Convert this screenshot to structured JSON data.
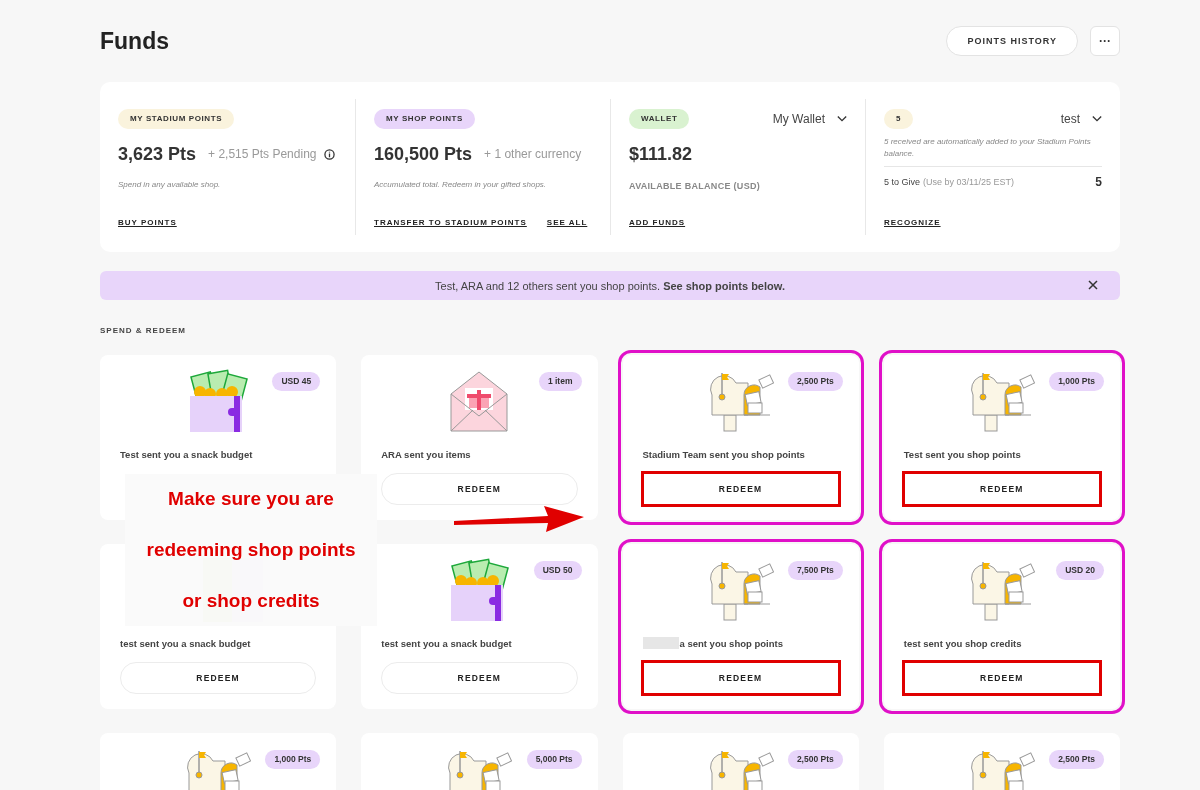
{
  "page": {
    "title": "Funds",
    "history_button": "POINTS HISTORY",
    "more_button": "···"
  },
  "panels": [
    {
      "kind": "points",
      "tag": "MY STADIUM POINTS",
      "color": "#faf3dd",
      "amount": "3,623 Pts",
      "extra": "+ 2,515 Pts Pending",
      "info": true,
      "note": "Spend in any available shop.",
      "links": [
        "BUY POINTS"
      ]
    },
    {
      "kind": "points",
      "tag": "MY SHOP POINTS",
      "color": "#e8d5fa",
      "amount": "160,500 Pts",
      "extra": "+ 1 other currency",
      "note": "Accumulated total. Redeem in your gifted shops.",
      "links": [
        "TRANSFER TO STADIUM POINTS",
        "SEE ALL"
      ]
    },
    {
      "kind": "wallet",
      "tag": "WALLET",
      "color": "#d9f2d0",
      "dropdown": "My Wallet",
      "amount": "$111.82",
      "caption": "AVAILABLE BALANCE (USD)",
      "links": [
        "ADD FUNDS"
      ]
    },
    {
      "kind": "give",
      "tag": "5",
      "color": "#faf3dd",
      "dropdown": "test",
      "note": "5 received are automatically added to your Stadium Points balance.",
      "give_label": "5 to Give",
      "give_expiry": "(Use by 03/11/25 EST)",
      "give_count": "5",
      "links": [
        "RECOGNIZE"
      ]
    }
  ],
  "banner": {
    "text": "Test, ARA and 12 others sent you shop points. **See shop points below.**"
  },
  "section_title": "SPEND & REDEEM",
  "cards": [
    {
      "kind": "wallet",
      "badge": "USD 45",
      "message": "Test sent you a snack budget",
      "highlighted": false,
      "name_redacted": false
    },
    {
      "kind": "envelope",
      "badge": "1 item",
      "message": "ARA sent you items",
      "button": "REDEEM",
      "highlighted": false,
      "name_redacted": false
    },
    {
      "kind": "mailbox",
      "badge": "2,500 Pts",
      "message": "Stadium Team sent you shop points",
      "button": "REDEEM",
      "highlighted": true,
      "name_redacted": false
    },
    {
      "kind": "mailbox",
      "badge": "1,000 Pts",
      "message": "Test sent you shop points",
      "button": "REDEEM",
      "highlighted": true,
      "name_redacted": false
    },
    {
      "kind": "blurred",
      "message": "test sent you a snack budget",
      "button": "REDEEM",
      "highlighted": false,
      "name_redacted": false
    },
    {
      "kind": "wallet",
      "badge": "USD 50",
      "message": "test sent you a snack budget",
      "button": "REDEEM",
      "highlighted": false,
      "name_redacted": false
    },
    {
      "kind": "mailbox",
      "badge": "7,500 Pts",
      "message": "a sent you shop points",
      "button": "REDEEM",
      "highlighted": true,
      "name_redacted": true
    },
    {
      "kind": "mailbox",
      "badge": "USD 20",
      "message": "test sent you shop credits",
      "button": "REDEEM",
      "highlighted": true,
      "name_redacted": false
    },
    {
      "kind": "mailbox",
      "badge": "1,000 Pts",
      "highlighted": false
    },
    {
      "kind": "mailbox",
      "badge": "5,000 Pts",
      "highlighted": false
    },
    {
      "kind": "mailbox",
      "badge": "2,500 Pts",
      "highlighted": false
    },
    {
      "kind": "mailbox",
      "badge": "2,500 Pts",
      "highlighted": false
    }
  ],
  "callout": {
    "lines": [
      "Make sure you are",
      "redeeming shop points",
      "or shop credits"
    ]
  }
}
